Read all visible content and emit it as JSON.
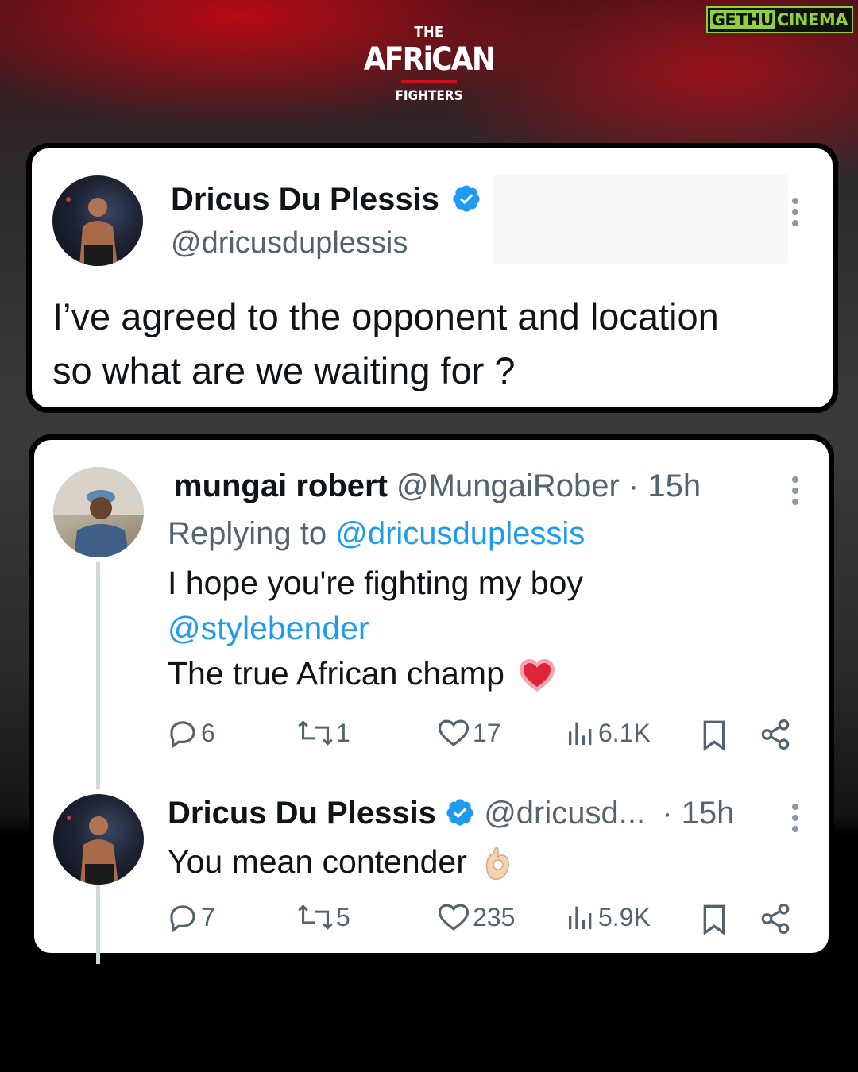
{
  "watermark": {
    "part1": "GETHU",
    "part2": "CINEMA"
  },
  "logo": {
    "top": "THE",
    "main": "AFRiCAN",
    "bottom": "FIGHTERS"
  },
  "tweet": {
    "author_name": "Dricus Du Plessis",
    "author_handle": "@dricusduplessis",
    "text_line1": "I’ve agreed to the opponent and location",
    "text_line2": "so what are we waiting for ?"
  },
  "reply1": {
    "author_name": "mungai robert",
    "author_handle": "@MungaiRober",
    "time": "· 15h",
    "replying_prefix": "Replying to ",
    "replying_handle": "@dricusduplessis",
    "text_line1": "I hope you're fighting my boy",
    "mention": "@stylebender",
    "text_line3": "The true African champ",
    "emoji": "heart",
    "replies": "6",
    "reposts": "1",
    "likes": "17",
    "views": "6.1K"
  },
  "reply2": {
    "author_name": "Dricus Du Plessis",
    "author_handle": "@dricusd...",
    "time": "· 15h",
    "text": "You mean contender",
    "emoji": "ok-hand",
    "replies": "7",
    "reposts": "5",
    "likes": "235",
    "views": "5.9K"
  },
  "colors": {
    "accent_blue": "#1d9bf0",
    "muted": "#536471",
    "brand_red": "#c8101e",
    "watermark_green": "#8fd13a"
  }
}
